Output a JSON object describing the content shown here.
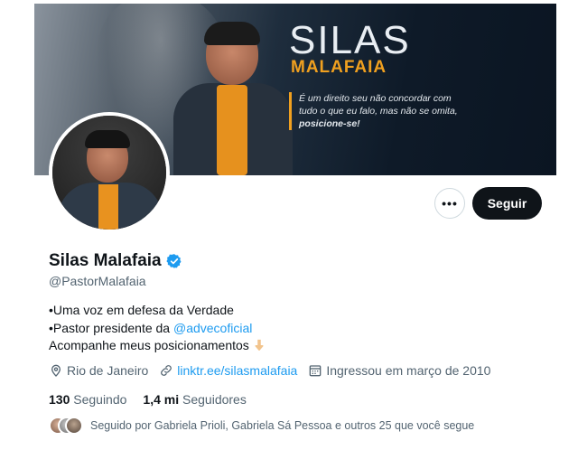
{
  "banner": {
    "title_line1": "SILAS",
    "title_line2": "MALAFAIA",
    "quote_part1": "É um direito seu não concordar com tudo o que eu falo, mas não se omita, ",
    "quote_bold": "posicione-se!"
  },
  "actions": {
    "more_label": "•••",
    "follow_label": "Seguir"
  },
  "profile": {
    "name": "Silas Malafaia",
    "handle": "@PastorMalafaia",
    "bio_line1": "•Uma voz em defesa da Verdade",
    "bio_line2_prefix": "•Pastor presidente da ",
    "bio_line2_mention": "@advecoficial",
    "bio_line3": "Acompanhe meus posicionamentos",
    "bio_emoji": "pointing-down-hand-emoji"
  },
  "meta": {
    "location": "Rio de Janeiro",
    "link": "linktr.ee/silasmalafaia",
    "joined": "Ingressou em março de 2010"
  },
  "stats": {
    "following_count": "130",
    "following_label": "Seguindo",
    "followers_count": "1,4 mi",
    "followers_label": "Seguidores"
  },
  "followed_by": {
    "text": "Seguido por Gabriela Prioli, Gabriela Sá Pessoa e outros 25 que você segue"
  },
  "colors": {
    "accent": "#1d9bf0",
    "follow_button": "#0f1419",
    "banner_orange": "#f0a01f"
  }
}
